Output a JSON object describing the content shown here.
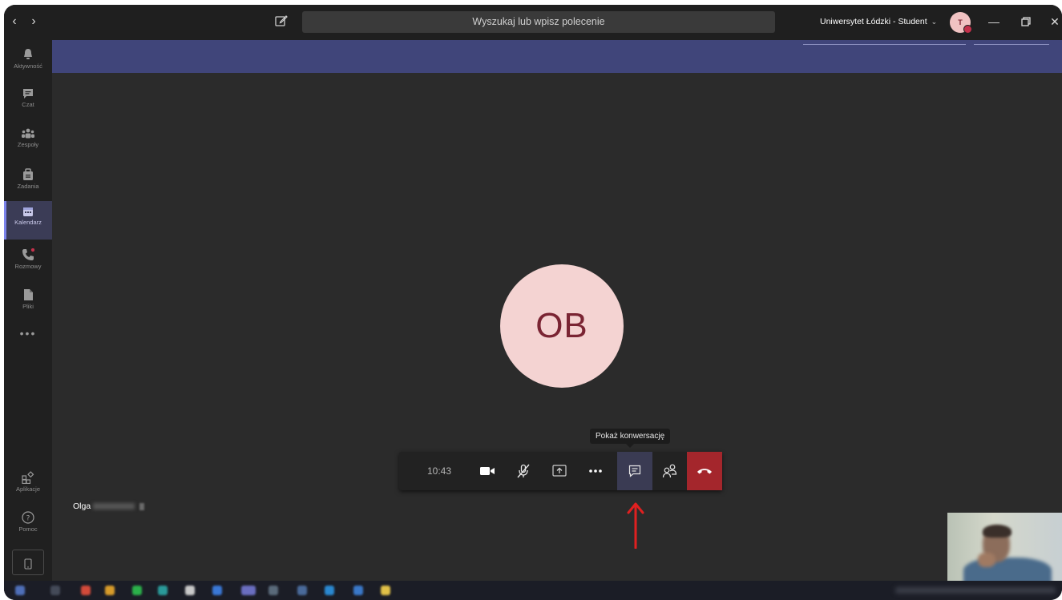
{
  "titlebar": {
    "search_placeholder": "Wyszukaj lub wpisz polecenie",
    "organization": "Uniwersytet Łódzki - Student",
    "avatar_initial": "T"
  },
  "rail": {
    "items": [
      {
        "label": "Aktywność",
        "icon": "bell-icon"
      },
      {
        "label": "Czat",
        "icon": "chat-icon"
      },
      {
        "label": "Zespoły",
        "icon": "teams-icon"
      },
      {
        "label": "Zadania",
        "icon": "assignments-icon"
      },
      {
        "label": "Kalendarz",
        "icon": "calendar-icon",
        "active": true
      },
      {
        "label": "Rozmowy",
        "icon": "phone-icon"
      },
      {
        "label": "Pliki",
        "icon": "file-icon"
      }
    ],
    "more": "•••",
    "apps_label": "Aplikacje",
    "help_label": "Pomoc"
  },
  "call": {
    "participant_initials": "OB",
    "participant_name": "Olga",
    "duration": "10:43",
    "tooltip": "Pokaż konwersację"
  },
  "colors": {
    "accent": "#40457a",
    "hangup": "#a4262c",
    "arrow": "#e02020",
    "avatar_bg": "#f4d3d2",
    "avatar_fg": "#7a2433"
  }
}
